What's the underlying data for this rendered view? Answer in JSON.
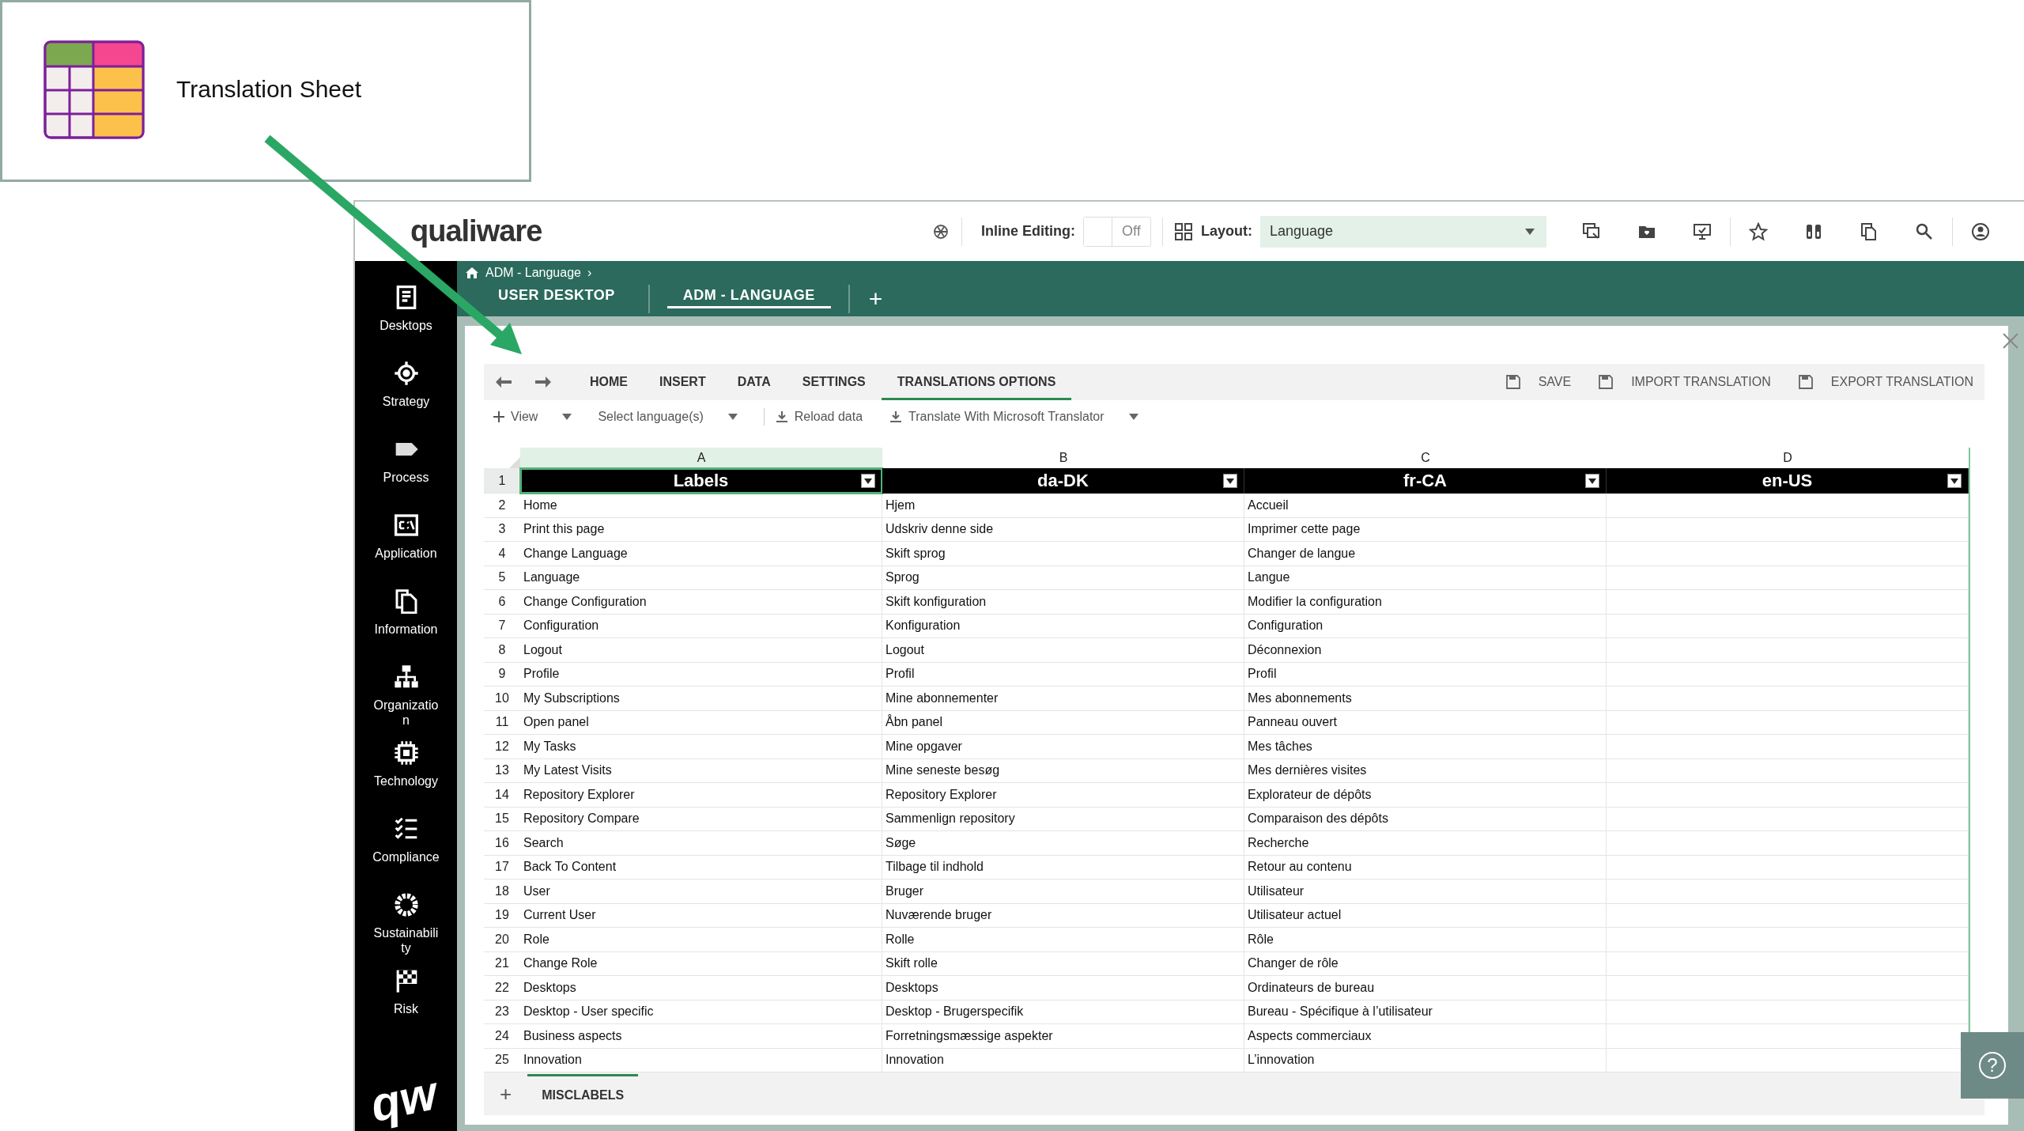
{
  "callout": {
    "title": "Translation Sheet"
  },
  "header": {
    "logo": "qualiware",
    "inline_editing": {
      "label": "Inline Editing:",
      "value": "Off",
      "on": false
    },
    "layout": {
      "label": "Layout:",
      "value": "Language"
    }
  },
  "sidebar": {
    "items": [
      {
        "label": "Desktops"
      },
      {
        "label": "Strategy"
      },
      {
        "label": "Process"
      },
      {
        "label": "Application"
      },
      {
        "label": "Information"
      },
      {
        "label": "Organization"
      },
      {
        "label": "Technology"
      },
      {
        "label": "Compliance"
      },
      {
        "label": "Sustainability"
      },
      {
        "label": "Risk"
      }
    ],
    "logo": "qw"
  },
  "breadcrumb": {
    "items": [
      "ADM - Language"
    ],
    "separator": "›"
  },
  "tabs": [
    {
      "label": "USER DESKTOP",
      "selected": false
    },
    {
      "label": "ADM - LANGUAGE",
      "selected": true
    }
  ],
  "add_tab": "+",
  "ribbon": {
    "tabs": [
      {
        "label": "HOME",
        "selected": false
      },
      {
        "label": "INSERT",
        "selected": false
      },
      {
        "label": "DATA",
        "selected": false
      },
      {
        "label": "SETTINGS",
        "selected": false
      },
      {
        "label": "TRANSLATIONS OPTIONS",
        "selected": true
      }
    ],
    "actions": [
      "SAVE",
      "IMPORT TRANSLATION",
      "EXPORT TRANSLATION"
    ]
  },
  "toolbar": [
    {
      "kind": "add",
      "label": "View",
      "caret": true
    },
    {
      "kind": "select",
      "label": "Select language(s)",
      "caret": true
    },
    {
      "kind": "download",
      "label": "Reload data",
      "caret": false
    },
    {
      "kind": "download",
      "label": "Translate With Microsoft Translator",
      "caret": true
    }
  ],
  "sheet": {
    "columns": [
      {
        "letter": "A",
        "selected": true
      },
      {
        "letter": "B",
        "selected": false
      },
      {
        "letter": "C",
        "selected": false
      },
      {
        "letter": "D",
        "selected": false
      }
    ],
    "header_row": {
      "number": "1",
      "selected": true,
      "cells": [
        "Labels",
        "da-DK",
        "fr-CA",
        "en-US"
      ]
    },
    "rows": [
      {
        "number": "2",
        "cells": [
          "Home",
          "Hjem",
          "Accueil"
        ]
      },
      {
        "number": "3",
        "cells": [
          "Print this page",
          "Udskriv denne side",
          "Imprimer cette page"
        ]
      },
      {
        "number": "4",
        "cells": [
          "Change Language",
          "Skift sprog",
          "Changer de langue"
        ]
      },
      {
        "number": "5",
        "cells": [
          "Language",
          "Sprog",
          "Langue"
        ]
      },
      {
        "number": "6",
        "cells": [
          "Change Configuration",
          "Skift konfiguration",
          "Modifier la configuration"
        ]
      },
      {
        "number": "7",
        "cells": [
          "Configuration",
          "Konfiguration",
          "Configuration"
        ]
      },
      {
        "number": "8",
        "cells": [
          "Logout",
          "Logout",
          "Déconnexion"
        ]
      },
      {
        "number": "9",
        "cells": [
          "Profile",
          "Profil",
          "Profil"
        ]
      },
      {
        "number": "10",
        "cells": [
          "My Subscriptions",
          "Mine abonnementer",
          "Mes abonnements"
        ]
      },
      {
        "number": "11",
        "cells": [
          "Open panel",
          "Åbn panel",
          "Panneau ouvert"
        ]
      },
      {
        "number": "12",
        "cells": [
          "My Tasks",
          "Mine opgaver",
          "Mes tâches"
        ]
      },
      {
        "number": "13",
        "cells": [
          "My Latest Visits",
          "Mine seneste besøg",
          "Mes dernières visites"
        ]
      },
      {
        "number": "14",
        "cells": [
          "Repository Explorer",
          "Repository Explorer",
          "Explorateur de dépôts"
        ]
      },
      {
        "number": "15",
        "cells": [
          "Repository Compare",
          "Sammenlign repository",
          "Comparaison des dépôts"
        ]
      },
      {
        "number": "16",
        "cells": [
          "Search",
          "Søge",
          "Recherche"
        ]
      },
      {
        "number": "17",
        "cells": [
          "Back To Content",
          "Tilbage til indhold",
          "Retour au contenu"
        ]
      },
      {
        "number": "18",
        "cells": [
          "User",
          "Bruger",
          "Utilisateur"
        ]
      },
      {
        "number": "19",
        "cells": [
          "Current User",
          "Nuværende bruger",
          "Utilisateur actuel"
        ]
      },
      {
        "number": "20",
        "cells": [
          "Role",
          "Rolle",
          "Rôle"
        ]
      },
      {
        "number": "21",
        "cells": [
          "Change Role",
          "Skift rolle",
          "Changer de rôle"
        ]
      },
      {
        "number": "22",
        "cells": [
          "Desktops",
          "Desktops",
          "Ordinateurs de bureau"
        ]
      },
      {
        "number": "23",
        "cells": [
          "Desktop - User specific",
          "Desktop - Brugerspecifik",
          "Bureau - Spécifique à l’utilisateur"
        ]
      },
      {
        "number": "24",
        "cells": [
          "Business aspects",
          "Forretningsmæssige aspekter",
          "Aspects commerciaux"
        ]
      },
      {
        "number": "25",
        "cells": [
          "Innovation",
          "Innovation",
          "L’innovation"
        ]
      }
    ]
  },
  "sheet_tabs": [
    {
      "label": "MISCLABELS",
      "selected": true
    }
  ],
  "add_sheet": "+",
  "help_button": "?"
}
